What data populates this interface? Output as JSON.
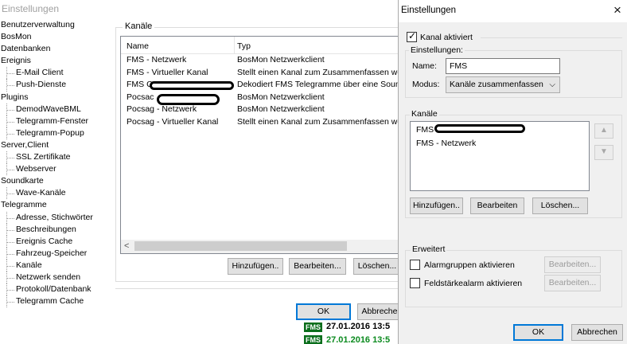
{
  "background": {
    "title": "Einstellungen",
    "tree": [
      {
        "label": "Benutzerverwaltung",
        "level": 0
      },
      {
        "label": "BosMon",
        "level": 0
      },
      {
        "label": "Datenbanken",
        "level": 0
      },
      {
        "label": "Ereignis",
        "level": 0
      },
      {
        "label": "E-Mail Client",
        "level": 1
      },
      {
        "label": "Push-Dienste",
        "level": 1
      },
      {
        "label": "Plugins",
        "level": 0
      },
      {
        "label": "DemodWaveBML",
        "level": 1
      },
      {
        "label": "Telegramm-Fenster",
        "level": 1
      },
      {
        "label": "Telegramm-Popup",
        "level": 1
      },
      {
        "label": "Server,Client",
        "level": 0
      },
      {
        "label": "SSL Zertifikate",
        "level": 1
      },
      {
        "label": "Webserver",
        "level": 1
      },
      {
        "label": "Soundkarte",
        "level": 0
      },
      {
        "label": "Wave-Kanäle",
        "level": 1
      },
      {
        "label": "Telegramme",
        "level": 0
      },
      {
        "label": "Adresse, Stichwörter",
        "level": 1
      },
      {
        "label": "Beschreibungen",
        "level": 1
      },
      {
        "label": "Ereignis Cache",
        "level": 1
      },
      {
        "label": "Fahrzeug-Speicher",
        "level": 1
      },
      {
        "label": "Kanäle",
        "level": 1
      },
      {
        "label": "Netzwerk senden",
        "level": 1
      },
      {
        "label": "Protokoll/Datenbank",
        "level": 1
      },
      {
        "label": "Telegramm Cache",
        "level": 1
      }
    ],
    "group_label": "Kanäle",
    "columns": {
      "name": "Name",
      "type": "Typ"
    },
    "rows": [
      {
        "name": "FMS - Netzwerk",
        "type": "BosMon Netzwerkclient"
      },
      {
        "name": "FMS - Virtueller Kanal",
        "type": "Stellt einen Kanal zum Zusammenfassen weit"
      },
      {
        "name": "FMS C",
        "type": "Dekodiert FMS Telegramme über eine Sound"
      },
      {
        "name": "Pocsac",
        "type": "BosMon Netzwerkclient"
      },
      {
        "name": "Pocsag - Netzwerk",
        "type": "BosMon Netzwerkclient"
      },
      {
        "name": "Pocsag - Virtueller Kanal",
        "type": "Stellt einen Kanal zum Zusammenfassen weit"
      }
    ],
    "buttons": {
      "add": "Hinzufügen..",
      "edit": "Bearbeiten...",
      "delete": "Löschen...",
      "ok": "OK",
      "cancel": "Abbreche"
    },
    "scroll_arrow": "<",
    "status_badge": "FMS",
    "status_stamps": [
      "27.01.2016 13:5",
      "27.01.2016 13:5"
    ],
    "colors": {
      "status_badge": "#0a6e1c",
      "stamp_top": "#000000",
      "stamp_bottom": "#0a8a1e"
    }
  },
  "dialog": {
    "title": "Einstellungen",
    "close_icon": "×",
    "channel_active_label": "Kanal aktiviert",
    "channel_active_checked": true,
    "check_mark": "✓",
    "settings_group_label": "Einstellungen:",
    "name_label": "Name:",
    "name_value": "FMS",
    "mode_label": "Modus:",
    "mode_value": "Kanäle zusammenfassen",
    "mode_chevron": "⌵",
    "channels_group_label": "Kanäle",
    "channels": [
      "FMS",
      "FMS - Netzwerk"
    ],
    "up_icon": "▲",
    "down_icon": "▼",
    "add_button": "Hinzufügen..",
    "edit_button": "Bearbeiten",
    "delete_button": "Löschen...",
    "advanced_group_label": "Erweitert",
    "alarm_groups_label": "Alarmgruppen aktivieren",
    "alarm_groups_checked": false,
    "alarm_groups_edit": "Bearbeiten...",
    "signal_alarm_label": "Feldstärkealarm aktivieren",
    "signal_alarm_checked": false,
    "signal_alarm_edit": "Bearbeiten...",
    "ok_button": "OK",
    "cancel_button": "Abbrechen",
    "colors": {
      "accent": "#0078d7"
    }
  }
}
